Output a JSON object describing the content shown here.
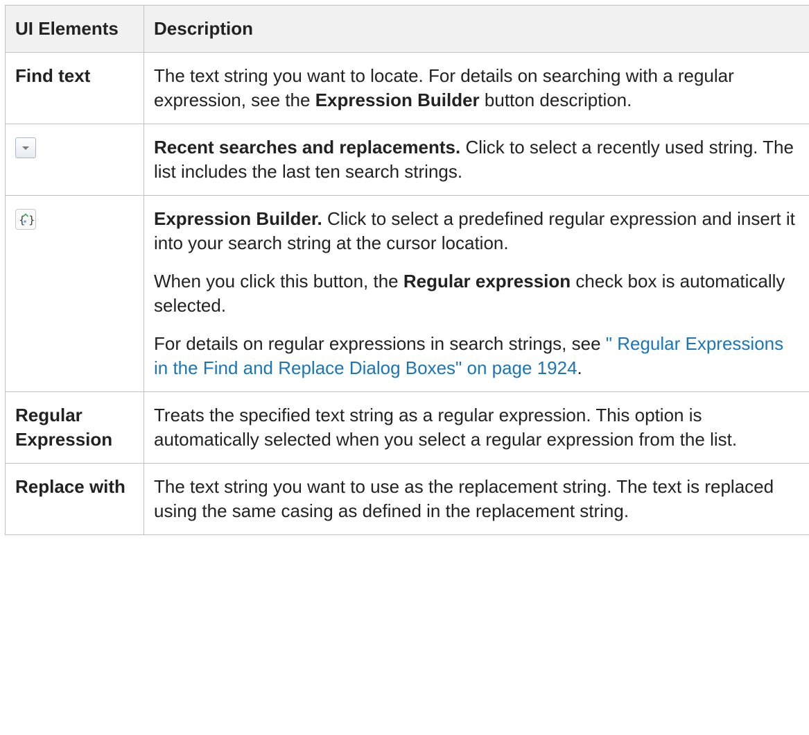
{
  "header": {
    "col1": "UI Elements",
    "col2": "Description"
  },
  "rows": [
    {
      "name": "Find text",
      "desc_a": "The text string you want to locate. For details on searching with a regular expression, see the ",
      "desc_bold": "Expression Builder",
      "desc_b": " button description."
    },
    {
      "icon": "dropdown-arrow-icon",
      "desc_bold": "Recent searches and replacements.",
      "desc_a": " Click to select a recently used string. The list includes the last ten search strings."
    },
    {
      "icon": "expression-builder-icon",
      "p1_bold": "Expression Builder.",
      "p1_text": " Click to select a predefined regular expression and insert it into your search string at the cursor location.",
      "p2_a": "When you click this button, the ",
      "p2_bold": "Regular expression",
      "p2_b": " check box is automatically selected.",
      "p3_a": "For details on regular expressions in search strings, see ",
      "p3_link": "\" Regular Expressions in the Find and Replace Dialog Boxes\" on page 1924",
      "p3_b": "."
    },
    {
      "name": "Regular Expression",
      "desc": "Treats the specified text string as a regular expression. This option is automatically selected when you select a regular expression from the list."
    },
    {
      "name": "Replace with",
      "desc": "The text string you want to use as the replacement string. The text is replaced using the same casing as defined in the replacement string."
    }
  ]
}
